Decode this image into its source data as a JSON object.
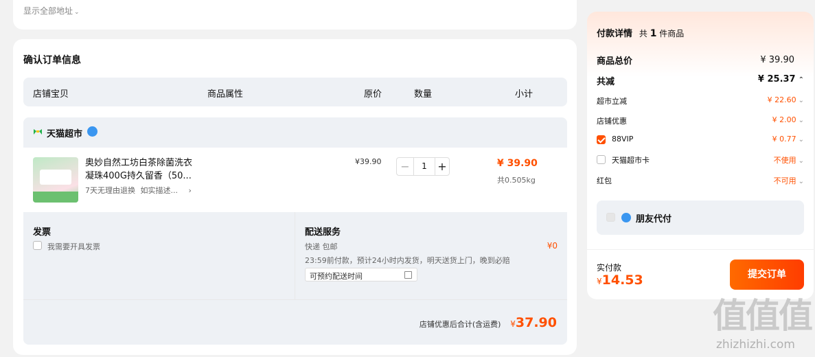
{
  "address": {
    "show_all_label": "显示全部地址"
  },
  "order": {
    "title": "确认订单信息",
    "columns": [
      "店铺宝贝",
      "商品属性",
      "原价",
      "数量",
      "小计"
    ],
    "store": {
      "name": "天猫超市"
    },
    "item": {
      "title_line1": "奥妙自然工坊白茶除菌洗衣",
      "title_line2": "凝珠400G持久留香（50...",
      "guarantee": "7天无理由退换",
      "desc": "如实描述...",
      "price": "¥39.90",
      "quantity": "1",
      "subtotal": "¥ 39.90",
      "weight": "共0.505kg",
      "minus": "−",
      "plus": "+"
    },
    "invoice": {
      "title": "发票",
      "option": "我需要开具发票"
    },
    "delivery": {
      "title": "配送服务",
      "method": "快递 包邮",
      "fee": "¥0",
      "note": "23:59前付款，预计24小时内发货，明天送货上门，晚到必赔",
      "schedule_placeholder": "可预约配送时间"
    },
    "total_label": "店铺优惠后合计(含运费)",
    "total_currency": "¥",
    "total_value": "37.90"
  },
  "payment": {
    "title": "付款详情",
    "count_prefix": "共",
    "count": "1",
    "count_suffix": "件商品",
    "goods_total_label": "商品总价",
    "goods_total": "¥ 39.90",
    "discount_label": "共减",
    "discount": "¥ 25.37",
    "rows": [
      {
        "label": "超市立减",
        "value": "¥ 22.60"
      },
      {
        "label": "店铺优惠",
        "value": "¥ 2.00"
      },
      {
        "label": "88VIP",
        "value": "¥ 0.77"
      },
      {
        "label": "天猫超市卡",
        "value": "不使用"
      },
      {
        "label": "红包",
        "value": "不可用"
      }
    ],
    "friend_pay": "朋友代付",
    "actual_label": "实付款",
    "actual_currency": "¥",
    "actual_value": "14.53",
    "submit_label": "提交订单"
  },
  "watermark": {
    "logo": "值值值",
    "url": "zhizhizhi.com"
  },
  "colors": {
    "accent": "#ff5000",
    "card": "#ffffff",
    "background": "#f2f2f2"
  }
}
